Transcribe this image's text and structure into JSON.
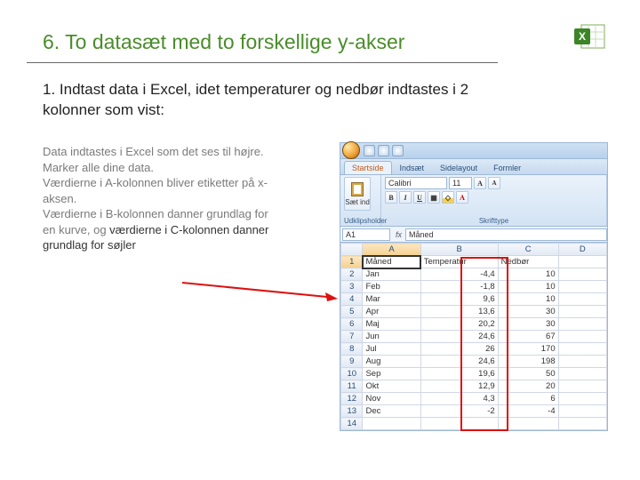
{
  "slide": {
    "number": "6.",
    "title": "To datasæt med to forskellige y-akser"
  },
  "instruction": {
    "num": "1.",
    "text": "Indtast data i Excel, idet temperaturer og nedbør indtastes i 2 kolonner som vist:"
  },
  "description": {
    "l1": "Data indtastes i Excel som det ses til højre.",
    "l2": "Marker alle dine data.",
    "l3": "Værdierne i A-kolonnen bliver etiketter på x-aksen.",
    "l4a": "Værdierne i B-kolonnen danner grundlag for en kurve, og ",
    "l4b": "værdierne i C-kolonnen danner grundlag for søjler"
  },
  "excel": {
    "tabs": {
      "t1": "Startside",
      "t2": "Indsæt",
      "t3": "Sidelayout",
      "t4": "Formler"
    },
    "groups": {
      "clipboard": "Udklipsholder",
      "font": "Skrifttype"
    },
    "paste": "Sæt ind",
    "fontName": "Calibri",
    "fontSize": "11",
    "nameBox": "A1",
    "fx": "fx",
    "formulaValue": "Måned",
    "columns": {
      "A": "A",
      "B": "B",
      "C": "C",
      "D": "D"
    },
    "headers": {
      "A": "Måned",
      "B": "Temperatur",
      "C": "Nedbør"
    },
    "rows": [
      {
        "n": "2",
        "a": "Jan",
        "b": "-4,4",
        "c": "10"
      },
      {
        "n": "3",
        "a": "Feb",
        "b": "-1,8",
        "c": "10"
      },
      {
        "n": "4",
        "a": "Mar",
        "b": "9,6",
        "c": "10"
      },
      {
        "n": "5",
        "a": "Apr",
        "b": "13,6",
        "c": "30"
      },
      {
        "n": "6",
        "a": "Maj",
        "b": "20,2",
        "c": "30"
      },
      {
        "n": "7",
        "a": "Jun",
        "b": "24,6",
        "c": "67"
      },
      {
        "n": "8",
        "a": "Jul",
        "b": "26",
        "c": "170"
      },
      {
        "n": "9",
        "a": "Aug",
        "b": "24,6",
        "c": "198"
      },
      {
        "n": "10",
        "a": "Sep",
        "b": "19,6",
        "c": "50"
      },
      {
        "n": "11",
        "a": "Okt",
        "b": "12,9",
        "c": "20"
      },
      {
        "n": "12",
        "a": "Nov",
        "b": "4,3",
        "c": "6"
      },
      {
        "n": "13",
        "a": "Dec",
        "b": "-2",
        "c": "-4"
      }
    ]
  },
  "chart_data": {
    "type": "table",
    "title": "Måned / Temperatur / Nedbør",
    "categories": [
      "Jan",
      "Feb",
      "Mar",
      "Apr",
      "Maj",
      "Jun",
      "Jul",
      "Aug",
      "Sep",
      "Okt",
      "Nov",
      "Dec"
    ],
    "series": [
      {
        "name": "Temperatur",
        "values": [
          -4.4,
          -1.8,
          9.6,
          13.6,
          20.2,
          24.6,
          26,
          24.6,
          19.6,
          12.9,
          4.3,
          -2
        ]
      },
      {
        "name": "Nedbør",
        "values": [
          10,
          10,
          10,
          30,
          30,
          67,
          170,
          198,
          50,
          20,
          6,
          -4
        ]
      }
    ]
  }
}
